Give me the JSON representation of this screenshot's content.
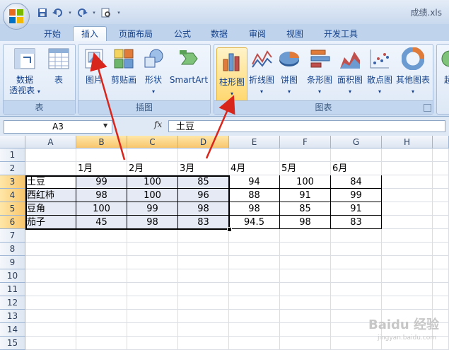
{
  "window": {
    "doc_title": "成绩.xls"
  },
  "tabs": [
    {
      "label": "开始"
    },
    {
      "label": "插入"
    },
    {
      "label": "页面布局"
    },
    {
      "label": "公式"
    },
    {
      "label": "数据"
    },
    {
      "label": "审阅"
    },
    {
      "label": "视图"
    },
    {
      "label": "开发工具"
    }
  ],
  "ribbon": {
    "groups": {
      "table": {
        "label": "表",
        "pivot_line1": "数据",
        "pivot_line2": "透视表",
        "table_label": "表"
      },
      "illustrations": {
        "label": "插图",
        "picture": "图片",
        "clipart": "剪贴画",
        "shapes": "形状",
        "smartart": "SmartArt"
      },
      "charts": {
        "label": "图表",
        "column": "柱形图",
        "line": "折线图",
        "pie": "饼图",
        "bar": "条形图",
        "area": "面积图",
        "scatter": "散点图",
        "other": "其他图表"
      },
      "partial": {
        "label": "超"
      }
    }
  },
  "formula_bar": {
    "name_box": "A3",
    "fx": "fx",
    "value": "土豆"
  },
  "columns": [
    "A",
    "B",
    "C",
    "D",
    "E",
    "F",
    "G",
    "H"
  ],
  "rows": [
    "1",
    "2",
    "3",
    "4",
    "5",
    "6",
    "7",
    "8",
    "9",
    "10",
    "11",
    "12",
    "13",
    "14",
    "15"
  ],
  "sheet": {
    "headers": [
      "1月",
      "2月",
      "3月",
      "4月",
      "5月",
      "6月"
    ],
    "data": [
      {
        "name": "土豆",
        "values": [
          "99",
          "100",
          "85",
          "94",
          "100",
          "84"
        ]
      },
      {
        "name": "西红柿",
        "values": [
          "98",
          "100",
          "96",
          "88",
          "91",
          "99"
        ]
      },
      {
        "name": "豆角",
        "values": [
          "100",
          "99",
          "98",
          "98",
          "85",
          "91"
        ]
      },
      {
        "name": "茄子",
        "values": [
          "45",
          "98",
          "83",
          "94.5",
          "98",
          "83"
        ]
      }
    ]
  },
  "watermark": {
    "main": "Baidu 经验",
    "sub": "jingyan.baidu.com"
  }
}
